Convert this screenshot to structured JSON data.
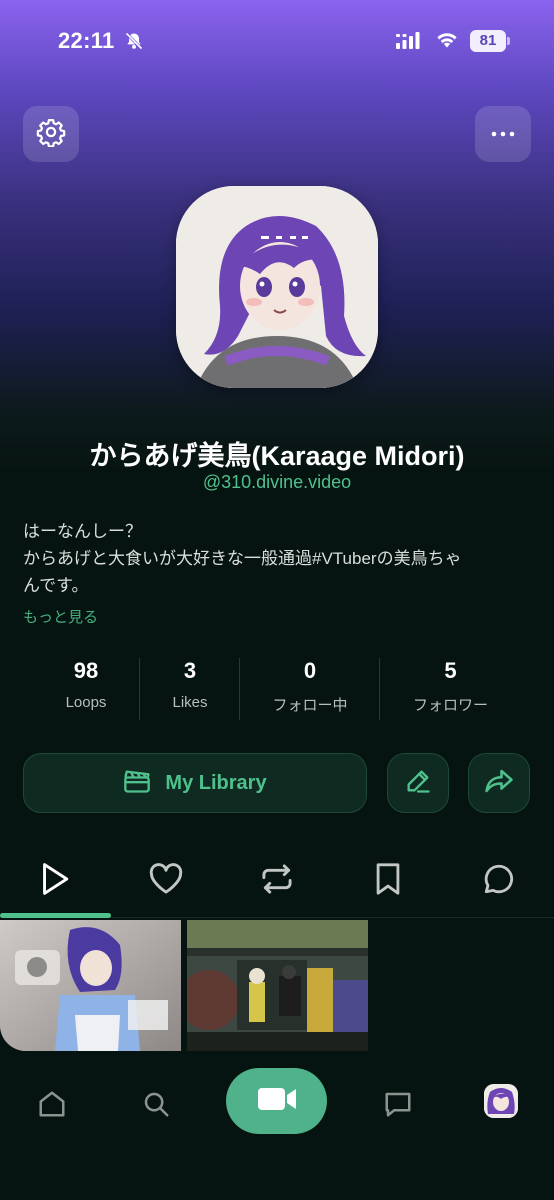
{
  "status_bar": {
    "time": "22:11",
    "battery": "81"
  },
  "profile": {
    "display_name": "からあげ美鳥(Karaage Midori)",
    "handle": "@310.divine.video",
    "bio_lines": [
      "はーなんしー？",
      "からあげと大食いが大好きな一般通過#VTuberの美鳥ちゃ",
      "んです。"
    ],
    "more_link": "もっと見る"
  },
  "stats": [
    {
      "value": "98",
      "label": "Loops"
    },
    {
      "value": "3",
      "label": "Likes"
    },
    {
      "value": "0",
      "label": "フォロー中"
    },
    {
      "value": "5",
      "label": "フォロワー"
    }
  ],
  "actions": {
    "library_label": "My Library"
  },
  "tabs": [
    {
      "icon": "play-icon",
      "active": true
    },
    {
      "icon": "heart-icon",
      "active": false
    },
    {
      "icon": "repost-icon",
      "active": false
    },
    {
      "icon": "bookmark-icon",
      "active": false
    },
    {
      "icon": "comment-icon",
      "active": false
    }
  ],
  "bottom_nav": [
    {
      "icon": "home-icon"
    },
    {
      "icon": "search-icon"
    },
    {
      "icon": "video-camera-icon"
    },
    {
      "icon": "message-icon"
    },
    {
      "icon": "profile-avatar"
    }
  ],
  "colors": {
    "accent": "#4fc18d",
    "background": "#061411",
    "gradient_top": "#8a63ee"
  }
}
